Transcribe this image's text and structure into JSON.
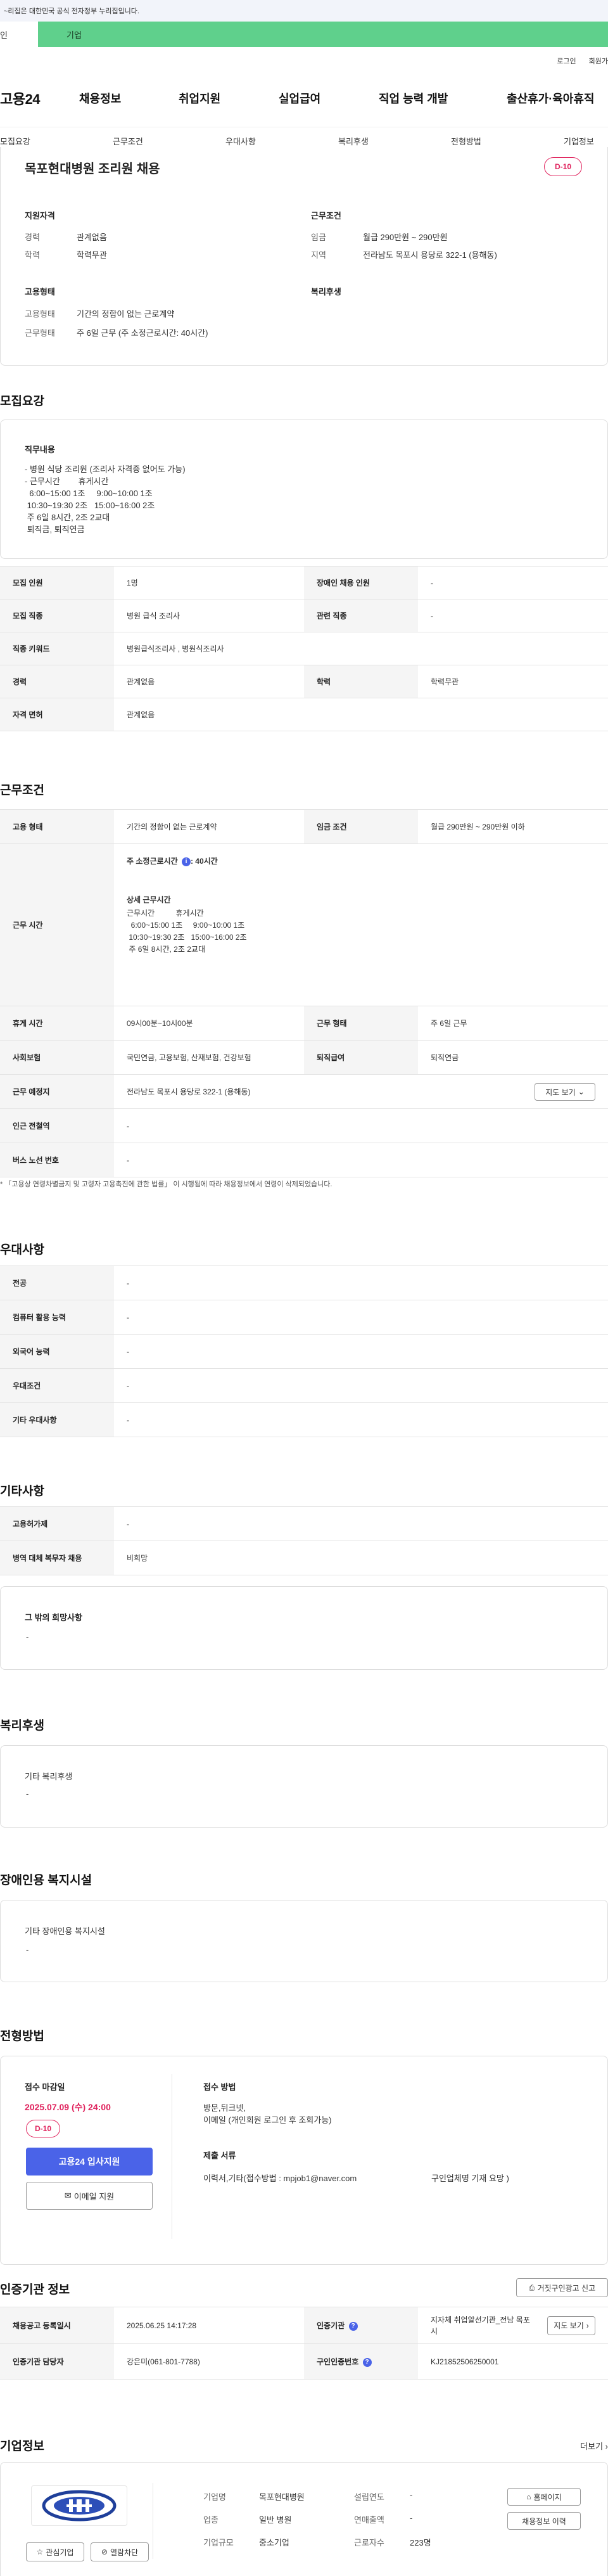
{
  "gov_banner": {
    "text": "~리집은 대한민국 공식 전자정부 누리집입니다."
  },
  "tabs": {
    "person": "인",
    "company": "기업"
  },
  "util": {
    "login": "로그인",
    "join": "회원가"
  },
  "gnb": {
    "logo": "고용24",
    "items": [
      "채용정보",
      "취업지원",
      "실업급여",
      "직업 능력 개발",
      "출산휴가·육아휴직"
    ]
  },
  "anchors": [
    "모집요강",
    "근무조건",
    "우대사항",
    "복리후생",
    "전형방법",
    "기업정보"
  ],
  "summary": {
    "title": "목포현대병원 조리원 채용",
    "dday": "D-10",
    "qual_head": "지원자격",
    "career_lbl": "경력",
    "career_val": "관계없음",
    "edu_lbl": "학력",
    "edu_val": "학력무관",
    "cond_head": "근무조건",
    "wage_lbl": "임금",
    "wage_val": "월급 290만원 ~ 290만원",
    "region_lbl": "지역",
    "region_val": "전라남도 목포시 용당로 322-1 (용해동)",
    "emp_head": "고용형태",
    "emptype_lbl": "고용형태",
    "emptype_val": "기간의 정함이 없는 근로계약",
    "worktype_lbl": "근무형태",
    "worktype_val": "주 6일 근무 (주 소정근로시간: 40시간)",
    "welfare_head": "복리후생"
  },
  "recruit": {
    "section_title": "모집요강",
    "duty_head": "직무내용",
    "duty_text": "- 병원 식당 조리원 (조리사 자격증 없어도 가능)\n- 근무시간        휴게시간\n  6:00~15:00 1조     9:00~10:00 1조\n 10:30~19:30 2조   15:00~16:00 2조\n 주 6일 8시간, 2조 2교대\n 퇴직금, 퇴직연금",
    "rows": [
      {
        "k1": "모집 인원",
        "v1": "1명",
        "k2": "장애인 채용 인원",
        "v2": "-"
      },
      {
        "k1": "모집 직종",
        "v1": "병원 급식 조리사",
        "k2": "관련 직종",
        "v2": "-"
      },
      {
        "k1": "직종 키워드",
        "v1": "병원급식조리사 , 병원식조리사"
      },
      {
        "k1": "경력",
        "v1": "관계없음",
        "k2": "학력",
        "v2": "학력무관"
      },
      {
        "k1": "자격 면허",
        "v1": "관계없음"
      }
    ]
  },
  "work": {
    "section_title": "근무조건",
    "emp_lbl": "고용 형태",
    "emp_val": "기간의 정함이 없는 근로계약",
    "wage_lbl": "임금 조건",
    "wage_val": "월급 290만원 ~ 290만원 이하",
    "time_lbl": "근무 시간",
    "weekly_hours": "주 소정근로시간",
    "weekly_hours_val": ": 40시간",
    "detail_head": "상세 근무시간",
    "detail_text": "근무시간          휴게시간\n  6:00~15:00 1조     9:00~10:00 1조\n 10:30~19:30 2조   15:00~16:00 2조\n 주 6일 8시간, 2조 2교대",
    "break_lbl": "휴게 시간",
    "break_val": "09시00분~10시00분",
    "form_lbl": "근무 형태",
    "form_val": "주 6일 근무",
    "ins_lbl": "사회보험",
    "ins_val": "국민연금, 고용보험, 산재보험, 건강보험",
    "sev_lbl": "퇴직급여",
    "sev_val": "퇴직연금",
    "place_lbl": "근무 예정지",
    "place_val": "전라남도 목포시 용당로 322-1 (용해동)",
    "map_btn": "지도 보기",
    "subway_lbl": "인근 전철역",
    "subway_val": "-",
    "bus_lbl": "버스 노선 번호",
    "bus_val": "-",
    "note": "「고용상 연령차별금지 및 고령자 고용촉진에 관한 법률」 이 시행됨에 따라 채용정보에서 연령이 삭제되었습니다."
  },
  "prefer": {
    "section_title": "우대사항",
    "rows": [
      {
        "k": "전공",
        "v": "-"
      },
      {
        "k": "컴퓨터 활용 능력",
        "v": "-"
      },
      {
        "k": "외국어 능력",
        "v": "-"
      },
      {
        "k": "우대조건",
        "v": "-"
      },
      {
        "k": "기타 우대사항",
        "v": "-"
      }
    ]
  },
  "etc": {
    "section_title": "기타사항",
    "rows": [
      {
        "k": "고용허가제",
        "v": "-"
      },
      {
        "k": "병역 대체 복무자 채용",
        "v": "비희망"
      }
    ],
    "other_head": "그 밖의 희망사항",
    "other_val": "-"
  },
  "welfare": {
    "section_title": "복리후생",
    "head": "기타 복리후생",
    "val": "-"
  },
  "disabled": {
    "section_title": "장애인용 복지시설",
    "head": "기타 장애인용 복지시설",
    "val": "-"
  },
  "apply": {
    "section_title": "전형방법",
    "deadline_head": "접수 마감일",
    "deadline_val": "2025.07.09 (수) 24:00",
    "dday": "D-10",
    "apply_btn": "고용24 입사지원",
    "email_btn": "이메일 지원",
    "method_head": "접수 방법",
    "method_val": "방문,뒤크넷,\n이메일 (개인회원 로그인 후 조회가능)",
    "docs_head": "제출 서류",
    "docs_val": "이력서,기타(접수방법 : mpjob1@naver.com",
    "docs_val2": "구인업체명 기재 요망 )"
  },
  "cert": {
    "section_title": "인증기관 정보",
    "report_btn": "거짓구인광고 신고",
    "reg_lbl": "채용공고 등록일시",
    "reg_val": "2025.06.25 14:17:28",
    "org_lbl": "인증기관",
    "org_val": "지자체 취업알선기관_전남 목포시",
    "map_btn": "지도 보기",
    "mgr_lbl": "인증기관 담당자",
    "mgr_val": "강은미(061-801-7788)",
    "no_lbl": "구인인증번호",
    "no_val": "KJ21852506250001"
  },
  "company": {
    "section_title": "기업정보",
    "more": "더보기",
    "name_lbl": "기업명",
    "name_val": "목포현대병원",
    "found_lbl": "설립연도",
    "found_val": "-",
    "ind_lbl": "업종",
    "ind_val": "일반 병원",
    "sales_lbl": "연매출액",
    "sales_val": "-",
    "size_lbl": "기업규모",
    "size_val": "중소기업",
    "emp_lbl": "근로자수",
    "emp_val": "223명",
    "home_btn": "홈페이지",
    "jobs_btn": "채용정보 이력",
    "fav_btn": "관심기업",
    "block_btn": "열람차단"
  }
}
